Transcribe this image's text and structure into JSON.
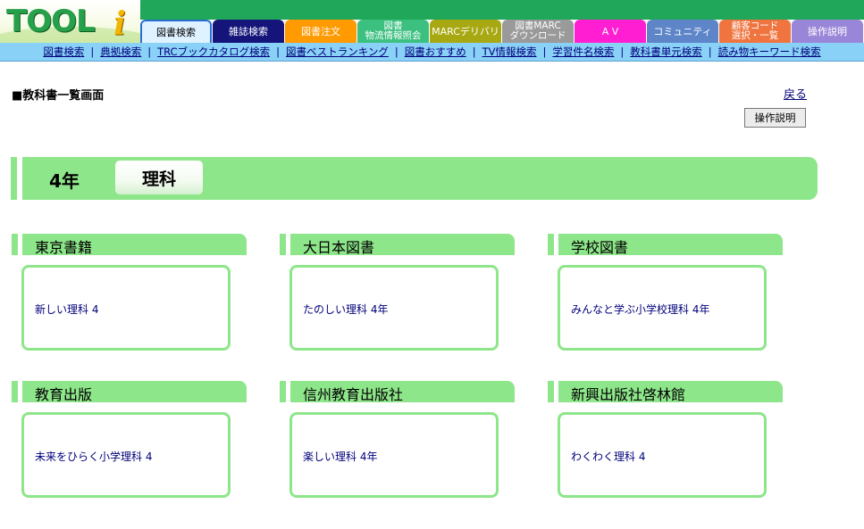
{
  "header": {
    "logo_text": "TOOL",
    "logo_i": "i",
    "tabs": [
      {
        "lines": [
          "図書検索"
        ],
        "color": "#2a8ee0",
        "width": 82,
        "active": true
      },
      {
        "lines": [
          "雑誌検索"
        ],
        "color": "#14147a",
        "width": 82
      },
      {
        "lines": [
          "図書注文"
        ],
        "color": "#ff9a00",
        "width": 82
      },
      {
        "lines": [
          "図書",
          "物流情報照会"
        ],
        "color": "#3cc080",
        "width": 82
      },
      {
        "lines": [
          "MARCデリバリ"
        ],
        "color": "#a8a812",
        "width": 82
      },
      {
        "lines": [
          "図書MARC",
          "ダウンロード"
        ],
        "color": "#9a9a9a",
        "width": 82
      },
      {
        "lines": [
          "A V"
        ],
        "color": "#ff1ed2",
        "width": 82
      },
      {
        "lines": [
          "コミュニティ"
        ],
        "color": "#5d85c8",
        "width": 82
      },
      {
        "lines": [
          "顧客コード",
          "選択・一覧"
        ],
        "color": "#f0743f",
        "width": 82
      },
      {
        "lines": [
          "操作説明"
        ],
        "color": "#9a86d8",
        "width": 82
      }
    ],
    "subnav": [
      "図書検索",
      "典拠検索",
      "TRCブックカタログ検索",
      "図書ベストランキング",
      "図書おすすめ",
      "TV情報検索",
      "学習件名検索",
      "教科書単元検索",
      "読み物キーワード検索"
    ],
    "subnav_separator": "|"
  },
  "page": {
    "title": "■教科書一覧画面",
    "back_label": "戻る",
    "help_label": "操作説明"
  },
  "banner": {
    "grade": "4年",
    "subject": "理科"
  },
  "publishers": [
    {
      "name": "東京書籍",
      "book": "新しい理科 4"
    },
    {
      "name": "大日本図書",
      "book": "たのしい理科 4年"
    },
    {
      "name": "学校図書",
      "book": "みんなと学ぶ小学校理科 4年"
    },
    {
      "name": "教育出版",
      "book": "未来をひらく小学理科 4"
    },
    {
      "name": "信州教育出版社",
      "book": "楽しい理科 4年"
    },
    {
      "name": "新興出版社啓林館",
      "book": "わくわく理科 4"
    }
  ]
}
